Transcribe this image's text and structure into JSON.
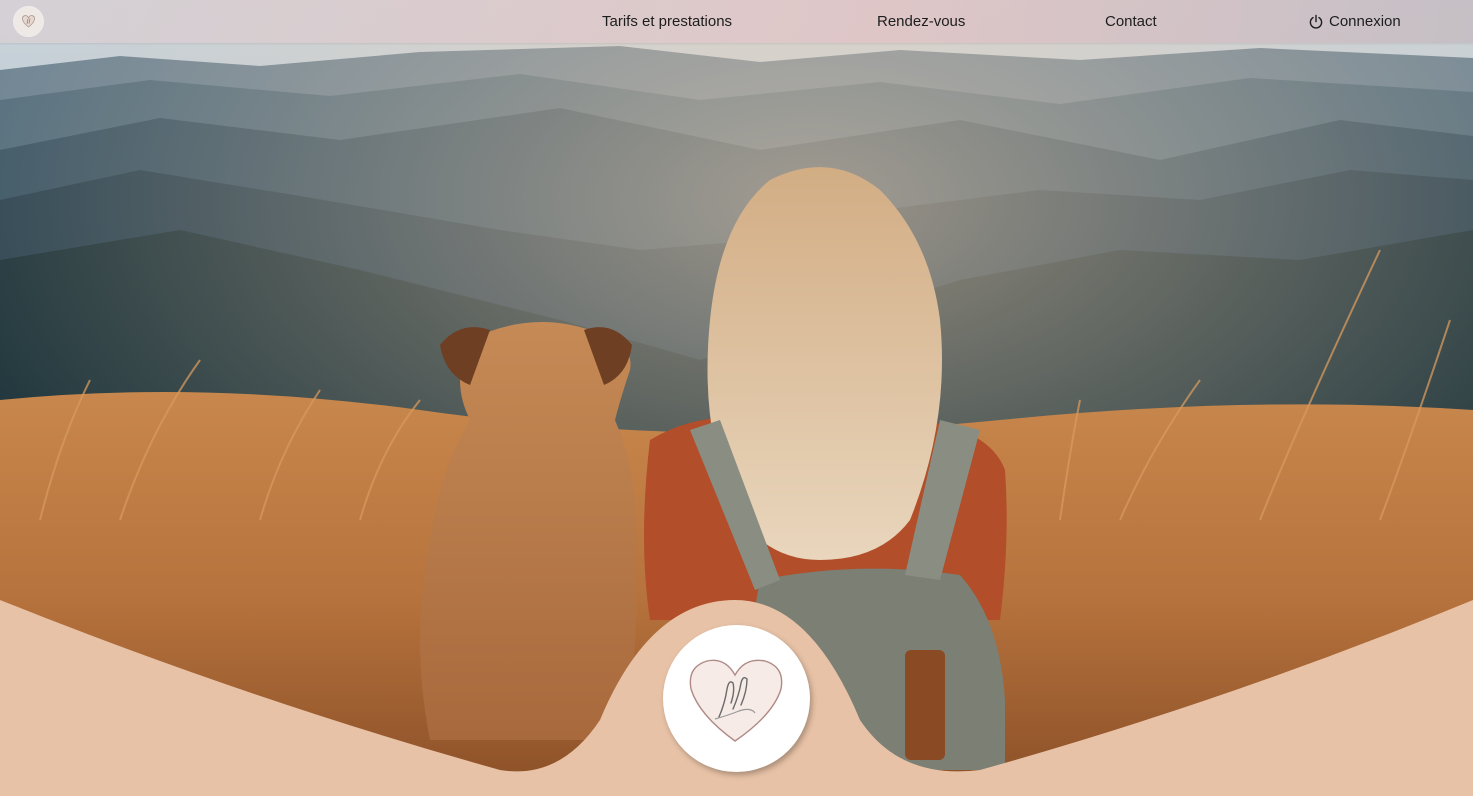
{
  "nav": {
    "logo_icon": "heart-hands-logo-icon",
    "links": [
      {
        "label": "Tarifs et prestations"
      },
      {
        "label": "Rendez-vous"
      },
      {
        "label": "Contact"
      }
    ],
    "login": {
      "label": "Connexion",
      "icon": "power-icon"
    }
  },
  "hero": {
    "image": "woman-and-dog-on-mountain-meadow",
    "badge_icon": "heart-hands-logo-icon"
  },
  "colors": {
    "nav_background": "#dcc9cb",
    "footer_wave": "#e8c2a6",
    "text": "#1d1d1d",
    "badge_background": "#ffffff"
  }
}
